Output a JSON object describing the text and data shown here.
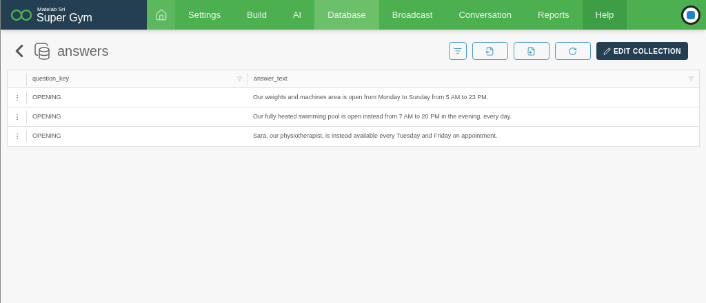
{
  "brand": {
    "company": "Matelab Srl",
    "app": "Super Gym"
  },
  "nav": [
    {
      "kind": "home",
      "selected": false
    },
    {
      "kind": "text",
      "label": "Settings",
      "selected": false
    },
    {
      "kind": "text",
      "label": "Build",
      "selected": false
    },
    {
      "kind": "text",
      "label": "AI",
      "selected": false
    },
    {
      "kind": "text",
      "label": "Database",
      "selected": true
    },
    {
      "kind": "text",
      "label": "Broadcast",
      "selected": false
    },
    {
      "kind": "text",
      "label": "Conversation",
      "selected": false
    },
    {
      "kind": "text",
      "label": "Reports",
      "selected": false
    },
    {
      "kind": "help",
      "label": "Help",
      "selected": false
    }
  ],
  "page": {
    "title": "answers",
    "edit_button": "EDIT COLLECTION"
  },
  "table": {
    "columns": [
      "question_key",
      "answer_text"
    ],
    "rows": [
      [
        "OPENING",
        "Our weights and machines area is open from Monday to Sunday from 5 AM to 23 PM."
      ],
      [
        "OPENING",
        "Our fully heated swimming pool is open instead from 7 AM to 20 PM in the evening, every day."
      ],
      [
        "OPENING",
        "Sara, our physiotherapist, is instead available every Tuesday and Friday on appointment."
      ]
    ]
  }
}
